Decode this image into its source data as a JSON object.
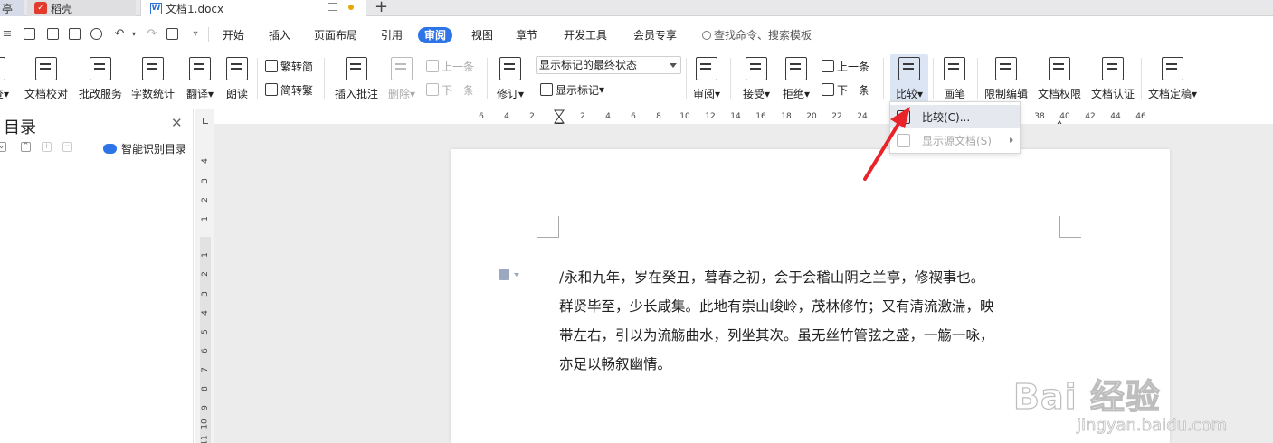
{
  "tabs": {
    "left_partial": "亭",
    "daoke": "稻壳",
    "document": "文档1.docx",
    "new_tab": "+"
  },
  "menu": {
    "items": [
      "开始",
      "插入",
      "页面布局",
      "引用",
      "审阅",
      "视图",
      "章节",
      "开发工具",
      "会员专享"
    ],
    "active": "审阅",
    "search_placeholder": "查找命令、搜索模板"
  },
  "ribbon": {
    "partial_left": "查",
    "doc_check": "文档校对",
    "revise_service": "批改服务",
    "word_count": "字数统计",
    "translate": "翻译",
    "read_aloud": "朗读",
    "trad_to_simp": "繁转简",
    "simp_to_trad": "简转繁",
    "insert_comment": "插入批注",
    "delete": "删除",
    "prev_item": "上一条",
    "next_item": "下一条",
    "revise": "修订",
    "markup_select": "显示标记的最终状态",
    "show_markup": "显示标记",
    "review": "审阅",
    "accept": "接受",
    "reject": "拒绝",
    "prev_change": "上一条",
    "next_change": "下一条",
    "compare": "比较",
    "brush": "画笔",
    "restrict_edit": "限制编辑",
    "doc_permission": "文档权限",
    "doc_certify": "文档认证",
    "doc_finalize": "文档定稿"
  },
  "nav": {
    "title": "目录",
    "smart_toc": "智能识别目录"
  },
  "ruler": {
    "h_ticks": [
      "6",
      "4",
      "2",
      "2",
      "4",
      "6",
      "8",
      "10",
      "12",
      "14",
      "16",
      "18",
      "20",
      "22",
      "24",
      "38",
      "40",
      "42",
      "44",
      "46"
    ],
    "v_ticks_top": [
      "4",
      "3",
      "2",
      "1"
    ],
    "v_ticks_bottom": [
      "1",
      "2",
      "3",
      "4",
      "5",
      "6",
      "7",
      "8",
      "9",
      "10",
      "11"
    ]
  },
  "dropdown": {
    "compare": "比较(C)...",
    "show_source": "显示源文档(S)"
  },
  "document": {
    "lines": [
      "/永和九年，岁在癸丑，暮春之初，会于会稽山阴之兰亭，修禊事也。",
      "群贤毕至，少长咸集。此地有崇山峻岭，茂林修竹；又有清流激湍，映",
      "带左右，引以为流觞曲水，列坐其次。虽无丝竹管弦之盛，一觞一咏，",
      "亦足以畅叙幽情。"
    ]
  },
  "watermark": {
    "main": "Bai 经验",
    "sub": "jingyan.baidu.com"
  },
  "colors": {
    "accent": "#2c74e8",
    "arrow": "#e8242a",
    "dot": "#e8a600"
  }
}
